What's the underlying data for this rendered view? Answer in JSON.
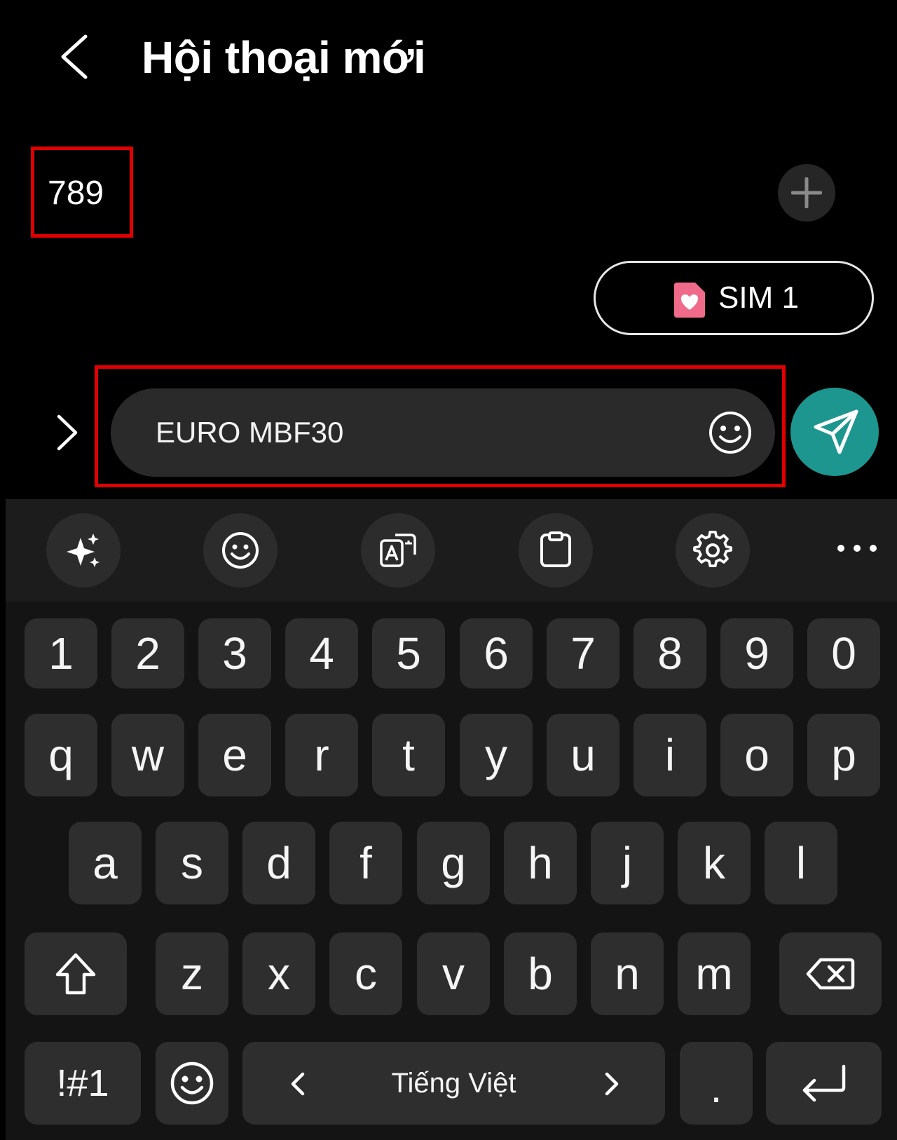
{
  "header": {
    "title": "Hội thoại mới"
  },
  "recipient": {
    "value": "789"
  },
  "sim": {
    "label": "SIM 1",
    "icon": "sim-heart-icon",
    "icon_color": "#f06a8a"
  },
  "composer": {
    "message": "EURO MBF30"
  },
  "colors": {
    "send_button": "#1e9690",
    "highlight": "#e00000"
  },
  "keyboard": {
    "toolbar": [
      "sparkle-icon",
      "emoji-icon",
      "translate-icon",
      "clipboard-icon",
      "gear-icon",
      "more-icon"
    ],
    "row_numbers": [
      "1",
      "2",
      "3",
      "4",
      "5",
      "6",
      "7",
      "8",
      "9",
      "0"
    ],
    "row_top": [
      "q",
      "w",
      "e",
      "r",
      "t",
      "y",
      "u",
      "i",
      "o",
      "p"
    ],
    "row_middle": [
      "a",
      "s",
      "d",
      "f",
      "g",
      "h",
      "j",
      "k",
      "l"
    ],
    "row_bottom": [
      "z",
      "x",
      "c",
      "v",
      "b",
      "n",
      "m"
    ],
    "symbols_label": "!#1",
    "language_label": "Tiếng Việt",
    "period_label": "."
  }
}
